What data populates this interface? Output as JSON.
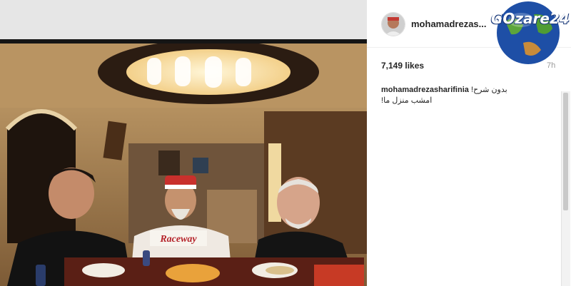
{
  "post": {
    "username": "mohamadrezas...",
    "likes": "7,149 likes",
    "time": "7h",
    "caption_user": "mohamadrezasharifinia",
    "caption_text_1": "!بدون شرح",
    "caption_text_2": "!امشب منزل ما"
  },
  "photo": {
    "shirt_text": "Raceway"
  },
  "watermark": {
    "text": "GOzare24"
  },
  "colors": {
    "panel_bg": "#ffffff",
    "text_dark": "#262626",
    "time_gray": "#999999"
  }
}
